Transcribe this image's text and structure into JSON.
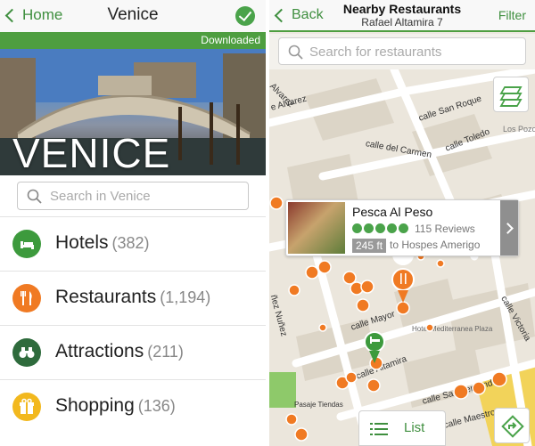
{
  "city_screen": {
    "nav": {
      "back_label": "Home",
      "title": "Venice"
    },
    "downloaded_label": "Downloaded",
    "hero_title": "VENICE",
    "search": {
      "placeholder": "Search in Venice"
    },
    "categories": [
      {
        "label": "Hotels",
        "count": "(382)",
        "icon": "bed-icon",
        "color": "#3d9a3d"
      },
      {
        "label": "Restaurants",
        "count": "(1,194)",
        "icon": "fork-knife-icon",
        "color": "#f07a23"
      },
      {
        "label": "Attractions",
        "count": "(211)",
        "icon": "binoculars-icon",
        "color": "#2e6b3c"
      },
      {
        "label": "Shopping",
        "count": "(136)",
        "icon": "gift-icon",
        "color": "#f2b81e"
      }
    ]
  },
  "map_screen": {
    "nav": {
      "back_label": "Back",
      "title": "Nearby Restaurants",
      "subtitle": "Rafael Altamira 7",
      "filter_label": "Filter"
    },
    "search": {
      "placeholder": "Search for restaurants"
    },
    "streets": [
      "Alvarez",
      "e Alvarez",
      "calle San Roque",
      "calle Toledo",
      "calle del Carmen",
      "Los Pozos",
      "calle Mayor",
      "Hotel Mediterranea Plaza",
      "calle Altamira",
      "calle San Fernando",
      "ñez Nuñez",
      "calle Victoria",
      "Pasaje Tiendas",
      "calle Maestro"
    ],
    "callout": {
      "name": "Pesca Al Peso",
      "rating_bubbles": 5,
      "reviews": "115 Reviews",
      "distance": "245 ft",
      "destination": "to Hospes Amerigo"
    },
    "list_button_label": "List",
    "colors": {
      "accent": "#4e9e40",
      "restaurant_pin": "#f07a23",
      "hotel_pin": "#3d9a3d"
    }
  }
}
